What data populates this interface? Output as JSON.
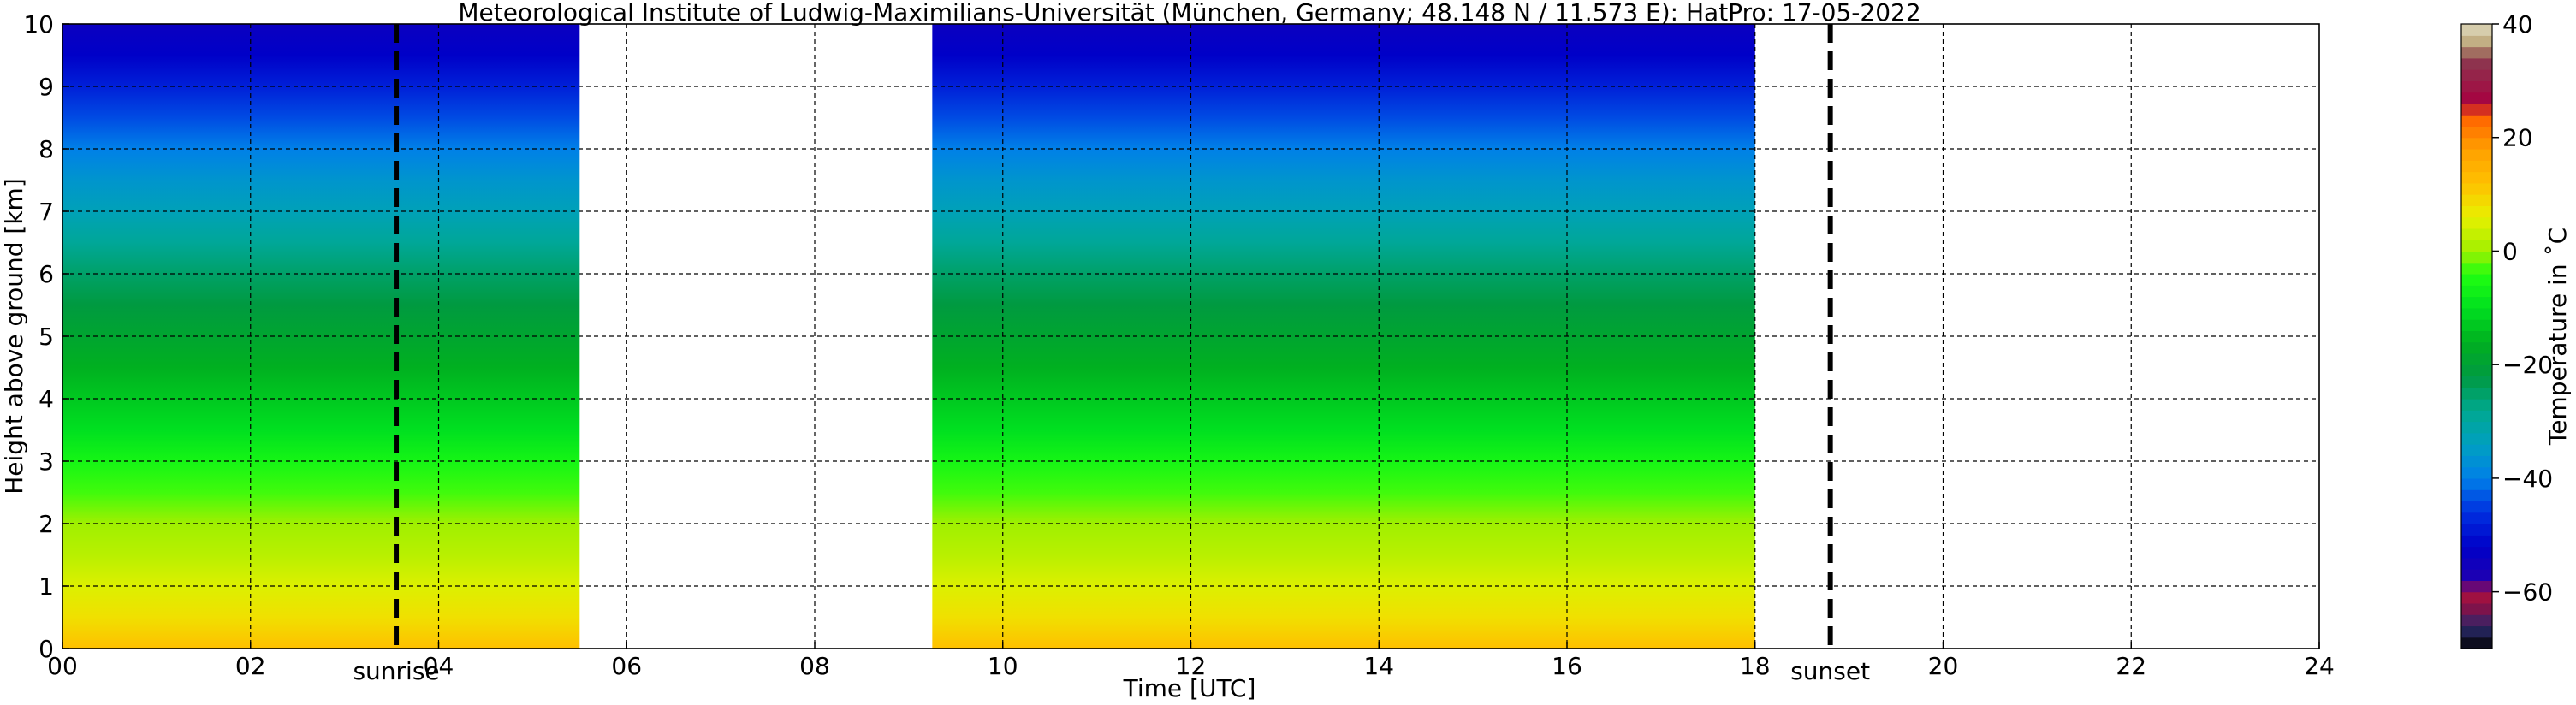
{
  "chart_data": {
    "type": "heatmap",
    "title": "Meteorological Institute of Ludwig-Maximilians-Universität (München, Germany; 48.148 N / 11.573 E):    HatPro: 17-05-2022",
    "xlabel": "Time [UTC]",
    "ylabel": "Height above ground [km]",
    "xlim": [
      0,
      24
    ],
    "ylim": [
      0,
      10
    ],
    "x_ticks": [
      "00",
      "02",
      "04",
      "06",
      "08",
      "10",
      "12",
      "14",
      "16",
      "18",
      "20",
      "22",
      "24"
    ],
    "y_ticks": [
      "0",
      "1",
      "2",
      "3",
      "4",
      "5",
      "6",
      "7",
      "8",
      "9",
      "10"
    ],
    "grid": true,
    "data_periods_utc": [
      [
        0.0,
        5.5
      ],
      [
        9.25,
        18.0
      ]
    ],
    "events": [
      {
        "label": "sunrise",
        "time_utc": 3.55
      },
      {
        "label": "sunset",
        "time_utc": 18.8
      }
    ],
    "temperature_profile": {
      "height_km": [
        0,
        0.5,
        1,
        1.5,
        2,
        2.5,
        3,
        3.5,
        4,
        4.5,
        5,
        5.5,
        6,
        6.5,
        7,
        7.5,
        8,
        8.5,
        9,
        9.5,
        10
      ],
      "temperature_c": [
        12,
        8,
        5,
        2,
        0,
        -3,
        -6,
        -10,
        -13,
        -16,
        -19,
        -22,
        -25,
        -29,
        -33,
        -36,
        -40,
        -44,
        -48,
        -52,
        -54
      ]
    },
    "colorbar": {
      "label": "Temperature in ˚C",
      "range": [
        -70,
        40
      ],
      "ticks": [
        "40",
        "20",
        "0",
        "−20",
        "−40",
        "−60"
      ],
      "colors": [
        {
          "t": -70,
          "color": "#000000"
        },
        {
          "t": -68,
          "color": "#1a1a3c"
        },
        {
          "t": -66,
          "color": "#2a2a6e"
        },
        {
          "t": -64,
          "color": "#6c1450"
        },
        {
          "t": -60,
          "color": "#b0103c"
        },
        {
          "t": -58,
          "color": "#2000b0"
        },
        {
          "t": -52,
          "color": "#0000c8"
        },
        {
          "t": -46,
          "color": "#0030e0"
        },
        {
          "t": -40,
          "color": "#0080e8"
        },
        {
          "t": -34,
          "color": "#00a0c0"
        },
        {
          "t": -28,
          "color": "#00a890"
        },
        {
          "t": -22,
          "color": "#009a40"
        },
        {
          "t": -16,
          "color": "#00b020"
        },
        {
          "t": -10,
          "color": "#00e020"
        },
        {
          "t": -4,
          "color": "#20ff10"
        },
        {
          "t": 0,
          "color": "#a0f000"
        },
        {
          "t": 6,
          "color": "#e8f000"
        },
        {
          "t": 12,
          "color": "#ffc000"
        },
        {
          "t": 18,
          "color": "#ffa000"
        },
        {
          "t": 24,
          "color": "#ff6000"
        },
        {
          "t": 26,
          "color": "#a80040"
        },
        {
          "t": 34,
          "color": "#8a3a50"
        },
        {
          "t": 36,
          "color": "#b8a070"
        },
        {
          "t": 40,
          "color": "#e0dcc0"
        }
      ]
    }
  }
}
